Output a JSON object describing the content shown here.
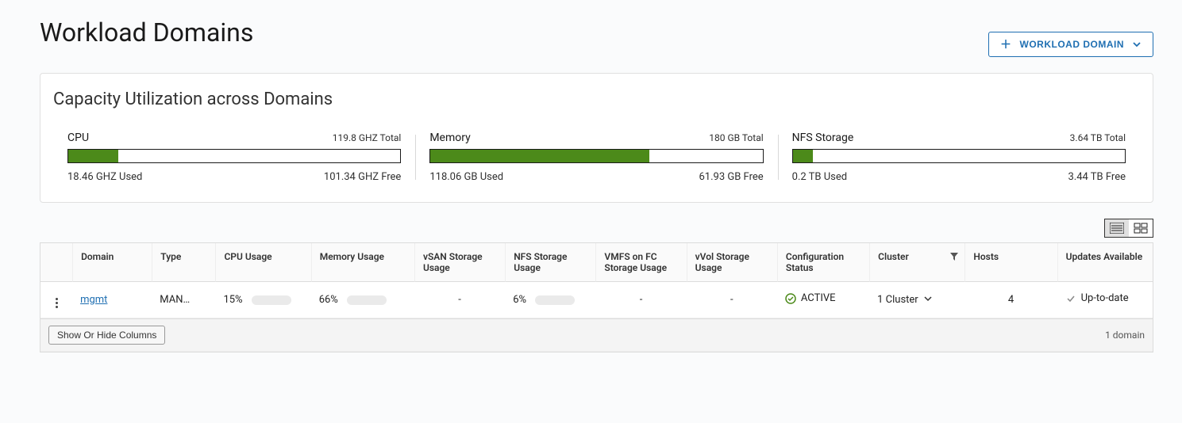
{
  "page": {
    "title": "Workload Domains"
  },
  "actions": {
    "dropdownLabel": "WORKLOAD DOMAIN"
  },
  "capacityCard": {
    "title": "Capacity Utilization across Domains",
    "metrics": [
      {
        "name": "CPU",
        "total": "119.8 GHZ Total",
        "used": "18.46 GHZ Used",
        "free": "101.34 GHZ Free",
        "pct": 15
      },
      {
        "name": "Memory",
        "total": "180 GB Total",
        "used": "118.06 GB Used",
        "free": "61.93 GB Free",
        "pct": 66
      },
      {
        "name": "NFS Storage",
        "total": "3.64 TB Total",
        "used": "0.2 TB Used",
        "free": "3.44 TB Free",
        "pct": 6
      }
    ]
  },
  "table": {
    "columns": {
      "domain": "Domain",
      "type": "Type",
      "cpu": "CPU Usage",
      "memory": "Memory Usage",
      "vsan": "vSAN Storage Usage",
      "nfs": "NFS Storage Usage",
      "vmfs": "VMFS on FC Storage Usage",
      "vvol": "vVol Storage Usage",
      "config": "Configuration Status",
      "cluster": "Cluster",
      "hosts": "Hosts",
      "updates": "Updates Available"
    },
    "rows": [
      {
        "domain": "mgmt",
        "type": "MAN…",
        "cpuPct": "15%",
        "cpuFill": 15,
        "memPct": "66%",
        "memFill": 66,
        "vsan": "-",
        "nfsPct": "6%",
        "nfsFill": 6,
        "vmfs": "-",
        "vvol": "-",
        "configStatus": "ACTIVE",
        "cluster": "1 Cluster",
        "hosts": "4",
        "updates": "Up-to-date"
      }
    ],
    "footer": {
      "showHide": "Show Or Hide Columns",
      "count": "1 domain"
    }
  }
}
